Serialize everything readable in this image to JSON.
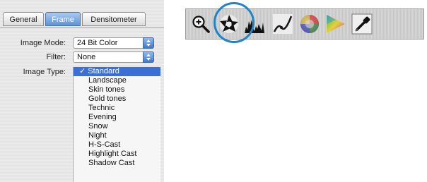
{
  "tabs": [
    {
      "label": "General"
    },
    {
      "label": "Frame"
    },
    {
      "label": "Densitometer"
    }
  ],
  "fields": {
    "image_mode": {
      "label": "Image Mode:",
      "value": "24 Bit Color"
    },
    "filter": {
      "label": "Filter:",
      "value": "None"
    },
    "image_type": {
      "label": "Image Type:"
    }
  },
  "image_type_menu": {
    "selected_mark": "✓",
    "items": [
      {
        "label": "Standard"
      },
      {
        "label": "Landscape"
      },
      {
        "label": "Skin tones"
      },
      {
        "label": "Gold tones"
      },
      {
        "label": "Technic"
      },
      {
        "label": "Evening"
      },
      {
        "label": "Snow"
      },
      {
        "label": "Night"
      },
      {
        "label": "H-S-Cast"
      },
      {
        "label": "Highlight Cast"
      },
      {
        "label": "Shadow Cast"
      }
    ]
  },
  "toolbar": {
    "tools": [
      {
        "icon": "zoom-in-icon"
      },
      {
        "icon": "aperture-icon"
      },
      {
        "icon": "histogram-icon"
      },
      {
        "icon": "gradation-curve-icon"
      },
      {
        "icon": "color-circle-icon"
      },
      {
        "icon": "color-triangle-icon"
      },
      {
        "icon": "eyedropper-icon"
      }
    ]
  },
  "colors": {
    "tab_active": "#5d93d8",
    "menu_selection": "#3a6fd8",
    "highlight_ring": "#1f84c8"
  }
}
